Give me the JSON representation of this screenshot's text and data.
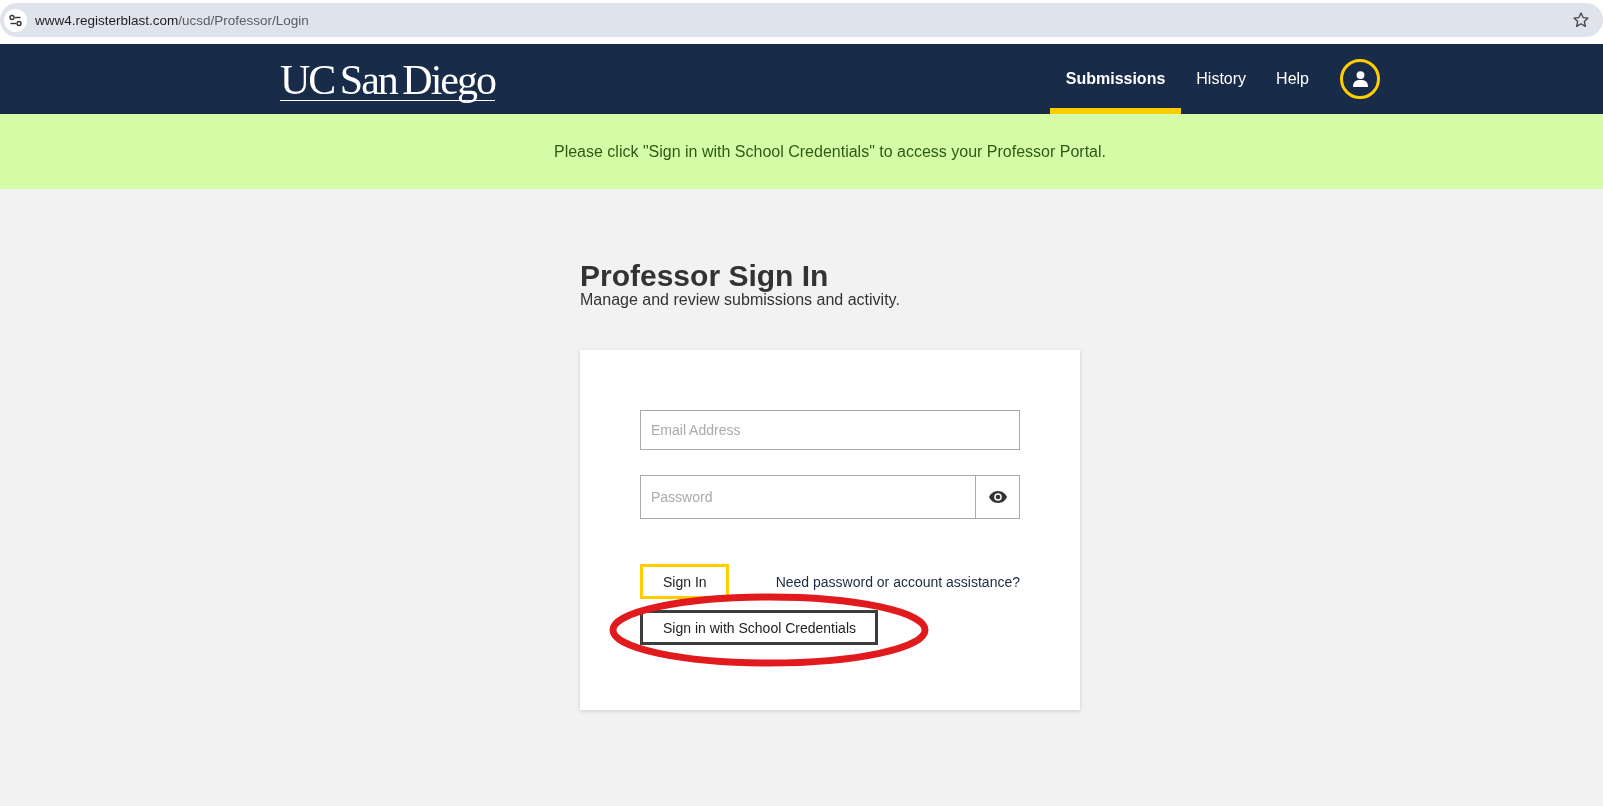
{
  "browser": {
    "url": "www4.registerblast.com/ucsd/Professor/Login"
  },
  "header": {
    "logo": "UC San Diego",
    "nav": [
      {
        "label": "Submissions",
        "selected": true
      },
      {
        "label": "History",
        "selected": false
      },
      {
        "label": "Help",
        "selected": false
      }
    ]
  },
  "banner": {
    "message": "Please click \"Sign in with School Credentials\" to access your Professor Portal."
  },
  "sign_in": {
    "title": "Professor Sign In",
    "subtitle": "Manage and review submissions and activity.",
    "fields": [
      {
        "kind": "email",
        "placeholder": "Email Address"
      },
      {
        "kind": "password",
        "placeholder": "Password"
      }
    ],
    "buttons": [
      {
        "kind": "primary",
        "label": "Sign In",
        "circled": false
      },
      {
        "kind": "secondary",
        "label": "Sign in with School Credentials",
        "circled": true
      }
    ],
    "help_link": "Need password or account assistance?"
  }
}
